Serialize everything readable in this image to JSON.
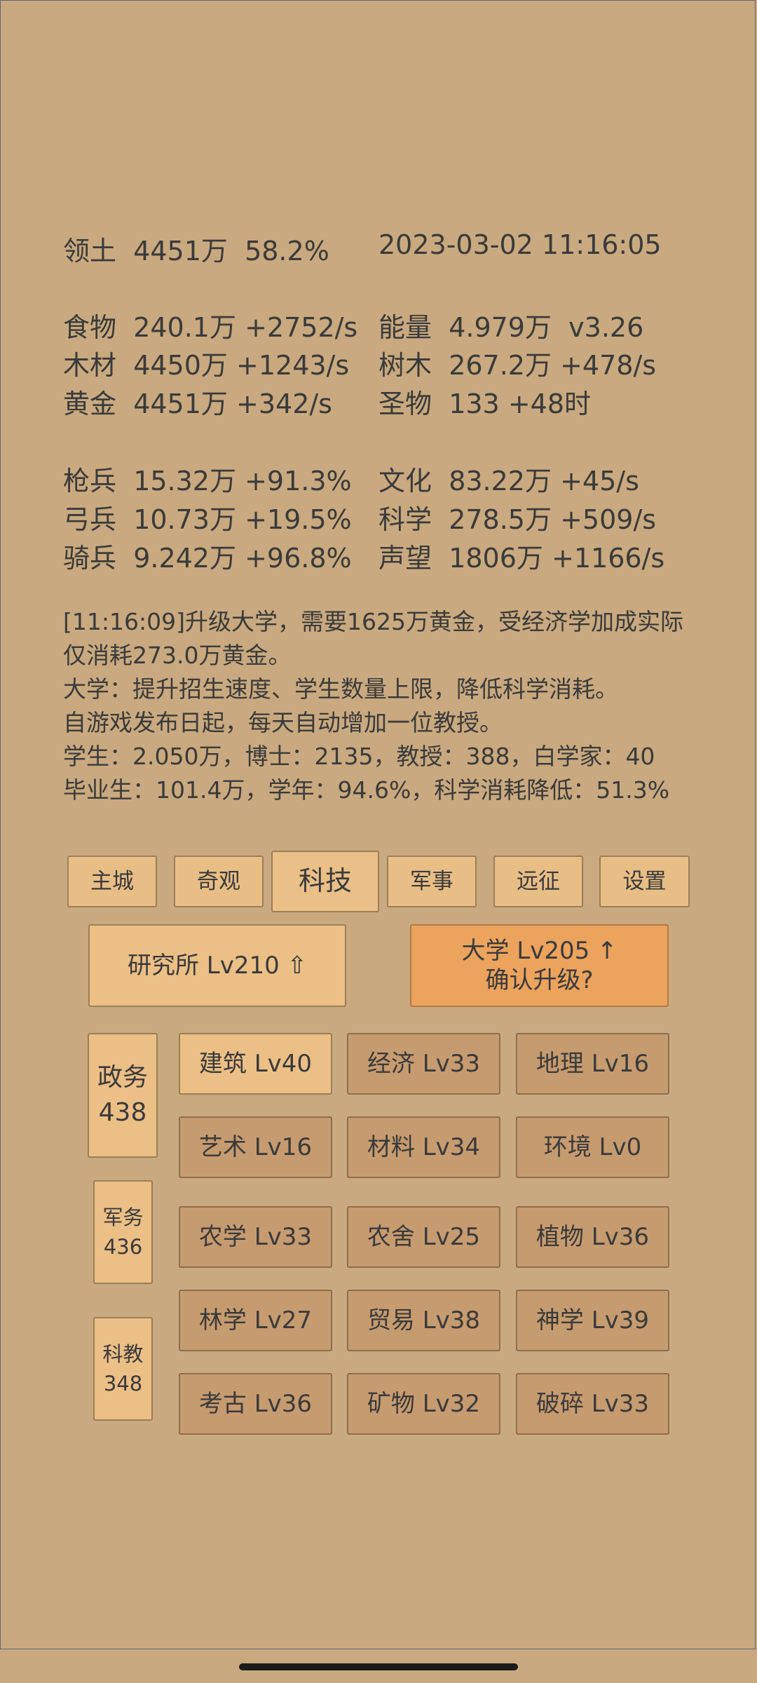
{
  "status": {
    "territory_label": "领土",
    "territory_value": "4451万",
    "territory_pct": "58.2%",
    "datetime": "2023-03-02 11:16:05"
  },
  "resources": [
    {
      "label": "食物",
      "value": "240.1万",
      "rate": "+2752/s"
    },
    {
      "label": "能量",
      "value": "4.979万",
      "rate": "v3.26"
    },
    {
      "label": "木材",
      "value": "4450万",
      "rate": "+1243/s"
    },
    {
      "label": "树木",
      "value": "267.2万",
      "rate": "+478/s"
    },
    {
      "label": "黄金",
      "value": "4451万",
      "rate": "+342/s"
    },
    {
      "label": "圣物",
      "value": "133",
      "rate": "+48时"
    }
  ],
  "military": [
    {
      "label": "枪兵",
      "value": "15.32万",
      "rate": "+91.3%"
    },
    {
      "label": "文化",
      "value": "83.22万",
      "rate": "+45/s"
    },
    {
      "label": "弓兵",
      "value": "10.73万",
      "rate": "+19.5%"
    },
    {
      "label": "科学",
      "value": "278.5万",
      "rate": "+509/s"
    },
    {
      "label": "骑兵",
      "value": "9.242万",
      "rate": "+96.8%"
    },
    {
      "label": "声望",
      "value": "1806万",
      "rate": "+1166/s"
    }
  ],
  "log": [
    "[11:16:09]升级大学，需要1625万黄金，受经济学加成实际",
    "仅消耗273.0万黄金。",
    "大学：提升招生速度、学生数量上限，降低科学消耗。",
    "自游戏发布日起，每天自动增加一位教授。",
    "学生：2.050万，博士：2135，教授：388，白学家：40",
    "毕业生：101.4万，学年：94.6%，科学消耗降低：51.3%"
  ],
  "tabs": [
    "主城",
    "奇观",
    "科技",
    "军事",
    "远征",
    "设置"
  ],
  "active_tab": "科技",
  "buildings": {
    "institute": "研究所 Lv210 ⇧",
    "university_line1": "大学 Lv205 ↑",
    "university_line2": "确认升级?"
  },
  "categories": [
    {
      "name": "政务",
      "count": "438"
    },
    {
      "name": "军务",
      "count": "436"
    },
    {
      "name": "科教",
      "count": "348"
    }
  ],
  "techs": [
    "建筑 Lv40",
    "经济 Lv33",
    "地理 Lv16",
    "艺术 Lv16",
    "材料 Lv34",
    "环境 Lv0",
    "农学 Lv33",
    "农舍 Lv25",
    "植物 Lv36",
    "林学 Lv27",
    "贸易 Lv38",
    "神学 Lv39",
    "考古 Lv36",
    "矿物 Lv32",
    "破碎 Lv33"
  ]
}
